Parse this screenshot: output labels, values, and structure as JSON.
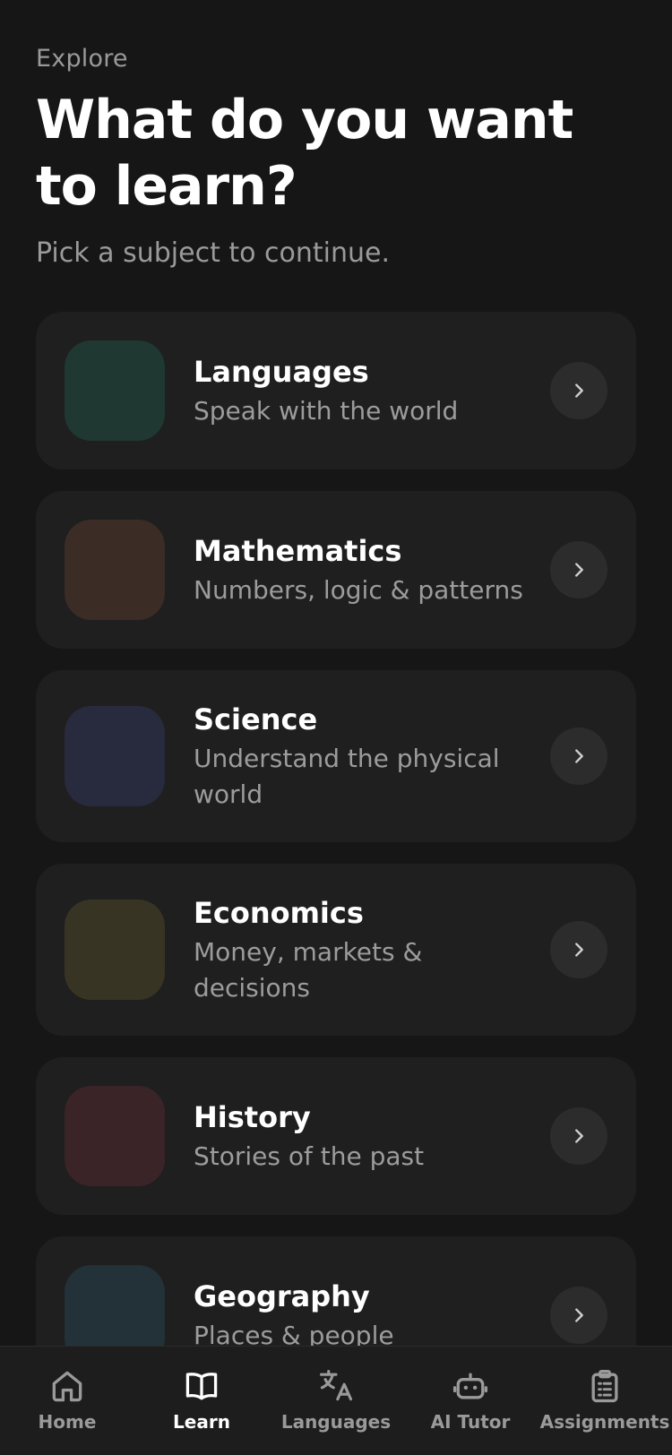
{
  "header": {
    "eyebrow": "Explore",
    "title": "What do you want to learn?",
    "subtitle": "Pick a subject to continue."
  },
  "subjects": [
    {
      "title": "Languages",
      "subtitle": "Speak with the world",
      "color": "#1f3832"
    },
    {
      "title": "Mathematics",
      "subtitle": "Numbers, logic & patterns",
      "color": "#3b2c26"
    },
    {
      "title": "Science",
      "subtitle": "Understand the physical world",
      "color": "#282a3e"
    },
    {
      "title": "Economics",
      "subtitle": "Money, markets & decisions",
      "color": "#383423"
    },
    {
      "title": "History",
      "subtitle": "Stories of the past",
      "color": "#3a2428"
    },
    {
      "title": "Geography",
      "subtitle": "Places & people",
      "color": "#223238"
    }
  ],
  "tabbar": {
    "items": [
      {
        "label": "Home",
        "icon": "home-icon",
        "active": false
      },
      {
        "label": "Learn",
        "icon": "book-icon",
        "active": true
      },
      {
        "label": "Languages",
        "icon": "translate-icon",
        "active": false
      },
      {
        "label": "AI Tutor",
        "icon": "robot-icon",
        "active": false
      },
      {
        "label": "Assignments",
        "icon": "clipboard-icon",
        "active": false
      }
    ]
  },
  "colors": {
    "background": "#161616",
    "card": "#1f1f1f",
    "muted_text": "#9a9a9a",
    "active_tab": "#ffffff"
  }
}
